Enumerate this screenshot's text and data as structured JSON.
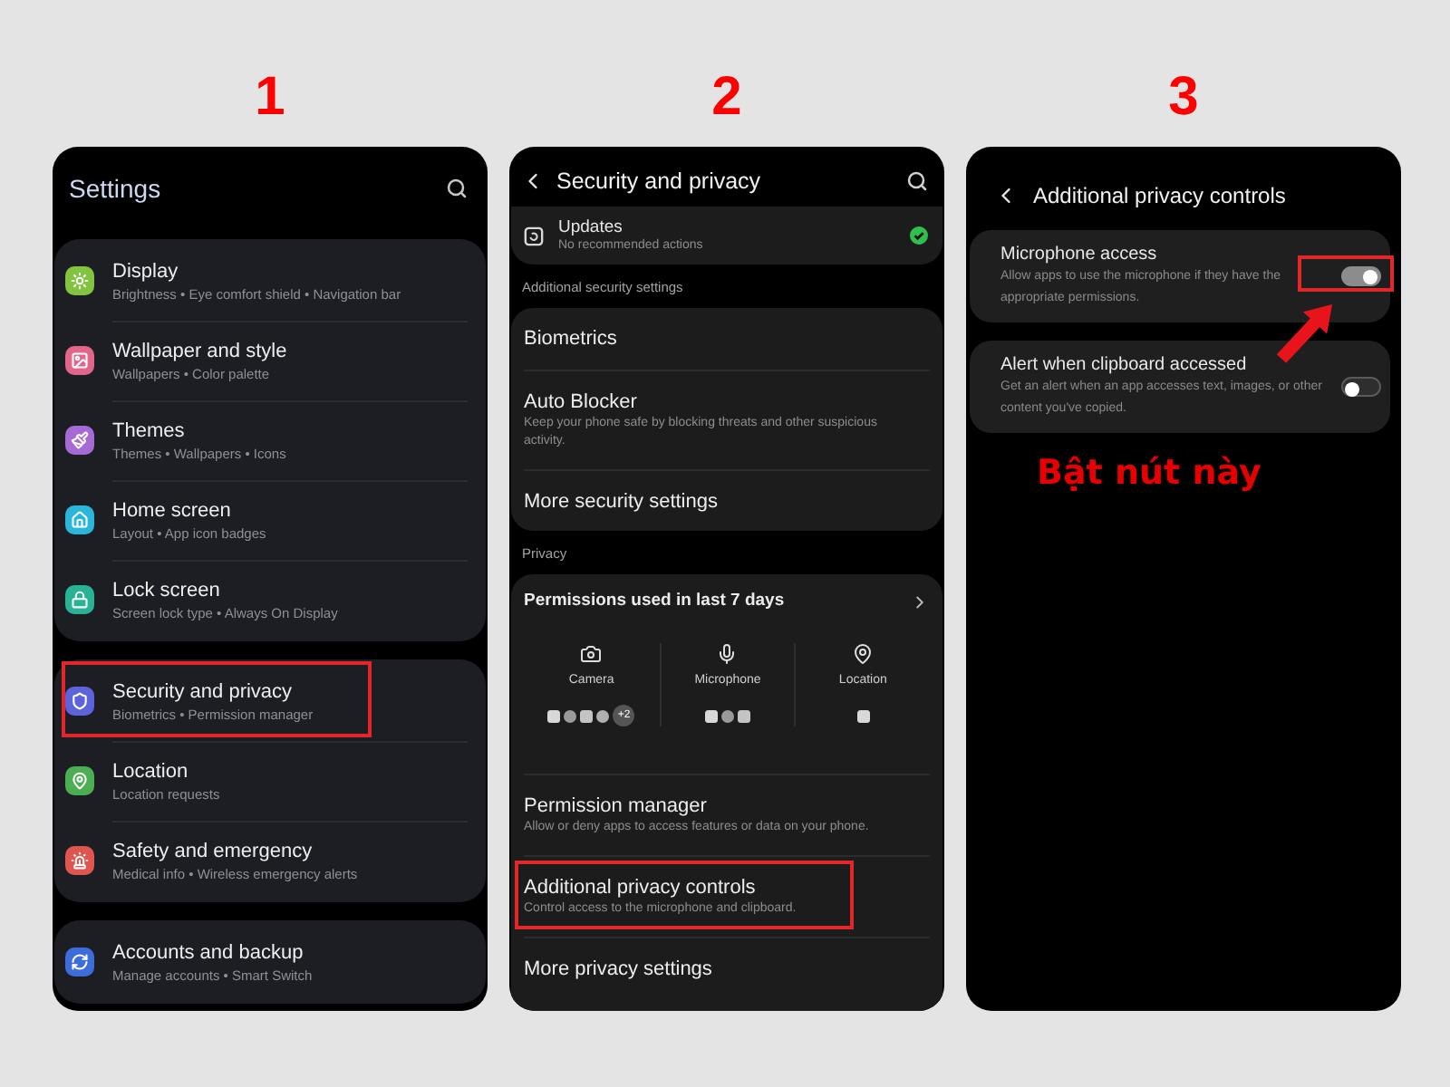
{
  "panels": [
    {
      "kind": "settings",
      "step": "1",
      "header": {
        "title": "Settings"
      },
      "groups": [
        {
          "items": [
            {
              "title": "Display",
              "subtitle": "Brightness • Eye comfort shield • Navigation bar",
              "color": "#82c341",
              "highlighted": false
            },
            {
              "title": "Wallpaper and style",
              "subtitle": "Wallpapers • Color palette",
              "color": "#e2668a",
              "highlighted": false
            },
            {
              "title": "Themes",
              "subtitle": "Themes • Wallpapers • Icons",
              "color": "#a56ad6",
              "highlighted": false
            },
            {
              "title": "Home screen",
              "subtitle": "Layout • App icon badges",
              "color": "#29b6d8",
              "highlighted": false
            },
            {
              "title": "Lock screen",
              "subtitle": "Screen lock type • Always On Display",
              "color": "#27b394",
              "highlighted": false
            }
          ]
        },
        {
          "items": [
            {
              "title": "Security and privacy",
              "subtitle": "Biometrics • Permission manager",
              "color": "#5c63db",
              "highlighted": true
            },
            {
              "title": "Location",
              "subtitle": "Location requests",
              "color": "#4cae52",
              "highlighted": false
            },
            {
              "title": "Safety and emergency",
              "subtitle": "Medical info • Wireless emergency alerts",
              "color": "#e0564e",
              "highlighted": false
            }
          ]
        },
        {
          "items": [
            {
              "title": "Accounts and backup",
              "subtitle": "Manage accounts • Smart Switch",
              "color": "#3c6ddb",
              "highlighted": false
            }
          ]
        }
      ]
    },
    {
      "kind": "security",
      "step": "2",
      "header": {
        "title": "Security and privacy"
      },
      "status_card": {
        "title": "Updates",
        "subtitle": "No recommended actions"
      },
      "sections": [
        {
          "label": "Additional security settings",
          "items": [
            {
              "title": "Biometrics",
              "highlighted": false
            },
            {
              "title": "Auto Blocker",
              "subtitle": "Keep your phone safe by blocking threats and other suspicious activity.",
              "highlighted": false
            },
            {
              "title": "More security settings",
              "highlighted": false
            }
          ]
        },
        {
          "label": "Privacy",
          "permissions": {
            "title": "Permissions used in last 7 days",
            "columns": [
              {
                "label": "Camera",
                "more": "+2"
              },
              {
                "label": "Microphone"
              },
              {
                "label": "Location"
              }
            ]
          },
          "items": [
            {
              "title": "Permission manager",
              "subtitle": "Allow or deny apps to access features or data on your phone.",
              "highlighted": false
            },
            {
              "title": "Additional privacy controls",
              "subtitle": "Control access to the microphone and clipboard.",
              "highlighted": true
            },
            {
              "title": "More privacy settings",
              "highlighted": false
            }
          ]
        }
      ]
    },
    {
      "kind": "privacy_controls",
      "step": "3",
      "header": {
        "title": "Additional privacy controls"
      },
      "items": [
        {
          "title": "Microphone access",
          "subtitle": "Allow apps to use the microphone if they have the appropriate permissions.",
          "on": true,
          "highlighted": true
        },
        {
          "title": "Alert when clipboard accessed",
          "subtitle": "Get an alert when an app accesses text, images, or other content you've copied.",
          "on": false,
          "highlighted": false
        }
      ],
      "callout": "Bật nút này"
    }
  ]
}
